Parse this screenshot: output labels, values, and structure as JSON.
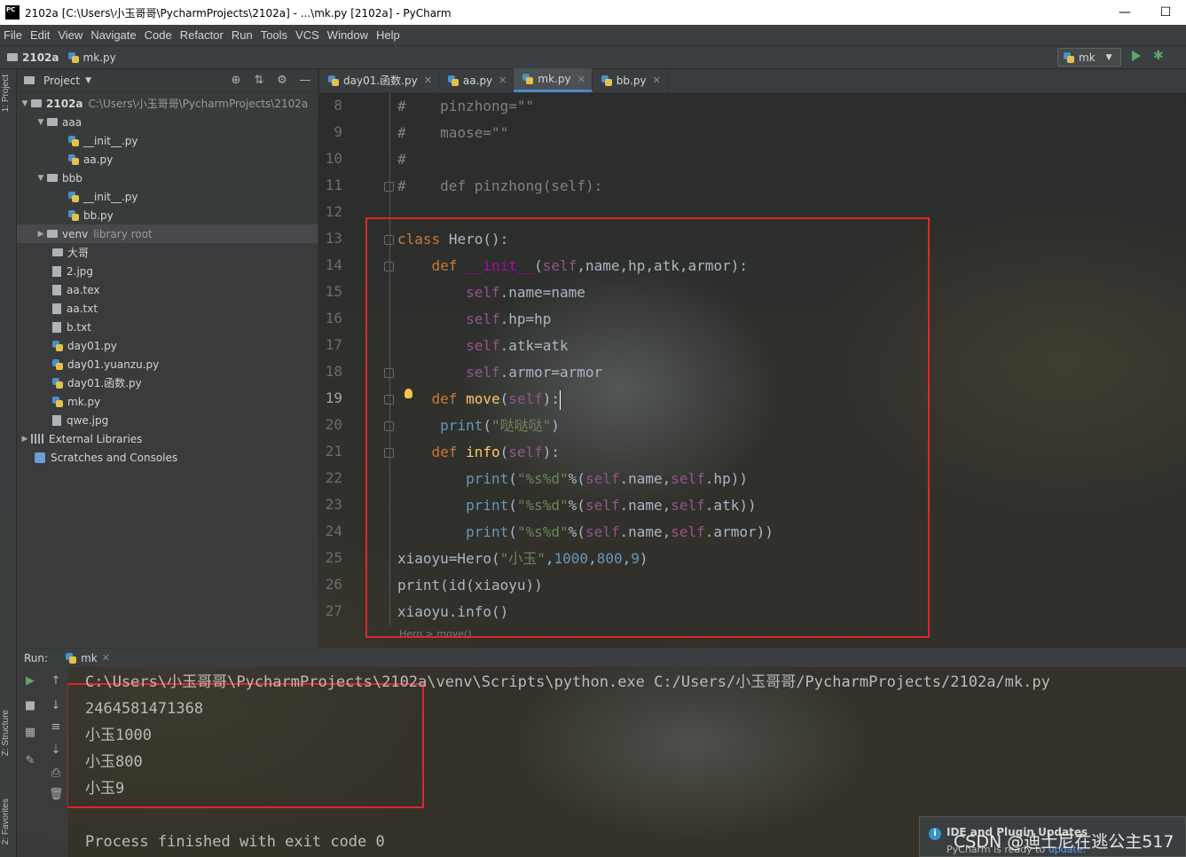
{
  "window": {
    "title": "2102a [C:\\Users\\小玉哥哥\\PycharmProjects\\2102a] - ...\\mk.py [2102a] - PyCharm",
    "logo_text": "PC"
  },
  "menu": [
    "File",
    "Edit",
    "View",
    "Navigate",
    "Code",
    "Refactor",
    "Run",
    "Tools",
    "VCS",
    "Window",
    "Help"
  ],
  "navbar": {
    "project": "2102a",
    "file": "mk.py",
    "run_config": "mk"
  },
  "tool_strip": {
    "project_tab": "1: Project",
    "structure_tab": "Z: Structure",
    "favorites_tab": "2: Favorites"
  },
  "project_panel": {
    "header": "Project",
    "tree": [
      {
        "label": "2102a",
        "suffix": "C:\\Users\\小玉哥哥\\PycharmProjects\\2102a"
      },
      {
        "label": "aaa"
      },
      {
        "label": "__init__.py"
      },
      {
        "label": "aa.py"
      },
      {
        "label": "bbb"
      },
      {
        "label": "__init__.py"
      },
      {
        "label": "bb.py"
      },
      {
        "label": "venv",
        "suffix": "library root"
      },
      {
        "label": "大哥"
      },
      {
        "label": "2.jpg"
      },
      {
        "label": "aa.tex"
      },
      {
        "label": "aa.txt"
      },
      {
        "label": "b.txt"
      },
      {
        "label": "day01.py"
      },
      {
        "label": "day01.yuanzu.py"
      },
      {
        "label": "day01.函数.py"
      },
      {
        "label": "mk.py"
      },
      {
        "label": "qwe.jpg"
      },
      {
        "label": "External Libraries"
      },
      {
        "label": "Scratches and Consoles"
      }
    ]
  },
  "editor": {
    "tabs": [
      "day01.函数.py",
      "aa.py",
      "mk.py",
      "bb.py"
    ],
    "active_tab": "mk.py",
    "line_numbers": [
      "8",
      "9",
      "10",
      "11",
      "12",
      "13",
      "14",
      "15",
      "16",
      "17",
      "18",
      "19",
      "20",
      "21",
      "22",
      "23",
      "24",
      "25",
      "26",
      "27"
    ],
    "current_line": "19",
    "tokens": {
      "hash": "#",
      "pinzhong_assign": "pinzhong=\"\"",
      "maose_assign": "maose=\"\"",
      "def": "def",
      "class": "class",
      "self": "self",
      "print": "print",
      "pinzhong_fn": "pinzhong",
      "self_paren": "(self):",
      "hero": "Hero",
      "parens_colon": "():",
      "init": "__init__",
      "open_paren": "(",
      "init_params": ",name,hp,atk,armor):",
      "name_assign": ".name=name",
      "hp_assign": ".hp=hp",
      "atk_assign": ".atk=atk",
      "armor_assign": ".armor=armor",
      "move": "move",
      "info": "info",
      "close_colon": "):",
      "dadada": "\"哒哒哒\"",
      "close_paren": ")",
      "fmt_str": "\"%s%d\"",
      "percent_paren": "%(",
      "dot_name_comma": ".name,",
      "dot_hp_close": ".hp))",
      "dot_atk_close": ".atk))",
      "dot_armor_close": ".armor))",
      "xiaoyu_assign": "xiaoyu=Hero(",
      "xiaoyu_str": "\"小玉\"",
      "comma": ",",
      "n1000": "1000",
      "n800": "800",
      "n9": "9",
      "print_id": "print(id(xiaoyu))",
      "xiaoyu_info": "xiaoyu.info()"
    },
    "breadcrumb": "Hero  >  move()"
  },
  "run_panel": {
    "label": "Run:",
    "tab": "mk",
    "output": [
      "C:\\Users\\小玉哥哥\\PycharmProjects\\2102a\\venv\\Scripts\\python.exe C:/Users/小玉哥哥/PycharmProjects/2102a/mk.py",
      "2464581471368",
      "小玉1000",
      "小玉800",
      "小玉9",
      "",
      "Process finished with exit code 0"
    ]
  },
  "notification": {
    "title": "IDE and Plugin Updates",
    "text": "PyCharm is ready to",
    "link": "update."
  },
  "watermark": "CSDN @迪士尼在逃公主517",
  "colors": {
    "keyword": "#cc7832",
    "self": "#94558d",
    "string": "#6a8759",
    "number": "#6897bb",
    "comment": "#808080",
    "function": "#ffc66d",
    "highlight_box": "#e0262a"
  }
}
